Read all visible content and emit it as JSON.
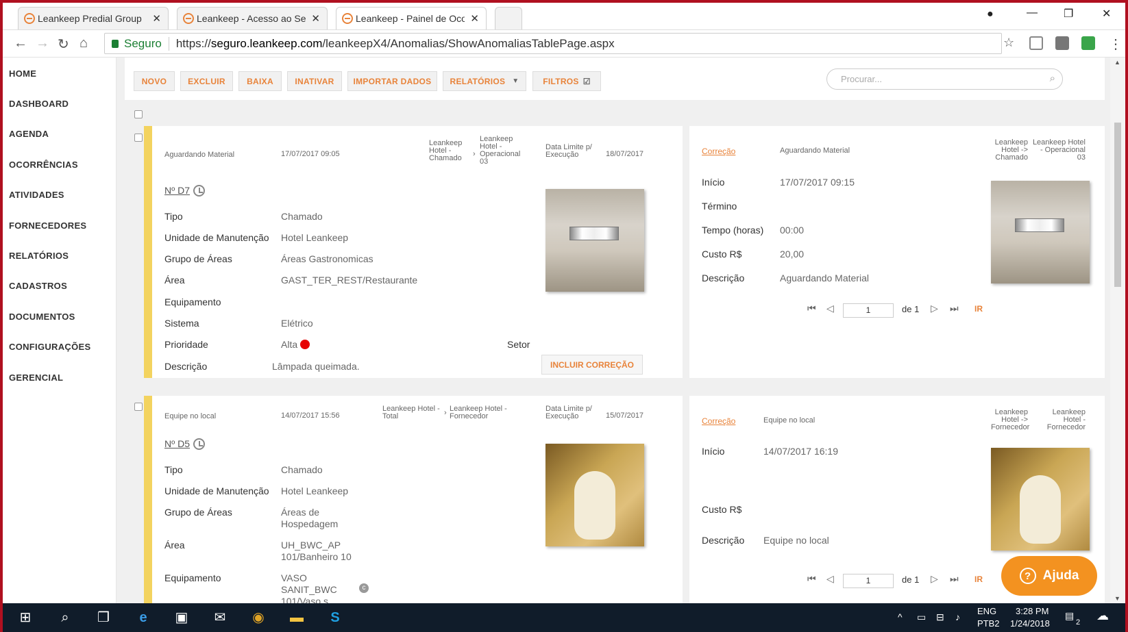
{
  "browser": {
    "tabs": [
      {
        "label": "Leankeep Predial Group"
      },
      {
        "label": "Leankeep - Acesso ao Se"
      },
      {
        "label": "Leankeep - Painel de Oco"
      }
    ],
    "secure_label": "Seguro",
    "url_prefix": "https://",
    "url_domain": "seguro.leankeep.com",
    "url_path": "/leankeepX4/Anomalias/ShowAnomaliasTablePage.aspx"
  },
  "sidebar": {
    "items": [
      "HOME",
      "DASHBOARD",
      "AGENDA",
      "OCORRÊNCIAS",
      "ATIVIDADES",
      "FORNECEDORES",
      "RELATÓRIOS",
      "CADASTROS",
      "DOCUMENTOS",
      "CONFIGURAÇÕES",
      "GERENCIAL"
    ]
  },
  "toolbar": {
    "novo": "NOVO",
    "excluir": "EXCLUIR",
    "baixa": "BAIXA",
    "inativar": "INATIVAR",
    "importar": "IMPORTAR DADOS",
    "relatorios": "RELATÓRIOS",
    "filtros": "FILTROS",
    "search_placeholder": "Procurar..."
  },
  "records": [
    {
      "status": "Aguardando Material",
      "datetime": "17/07/2017 09:05",
      "path_from": "Leankeep Hotel - Chamado",
      "path_to": "Leankeep Hotel - Operacional 03",
      "deadline_label": "Data Limite p/ Execução",
      "deadline": "18/07/2017",
      "number": "Nº D7",
      "fields": {
        "tipo_label": "Tipo",
        "tipo": "Chamado",
        "unidade_label": "Unidade de Manutenção",
        "unidade": "Hotel Leankeep",
        "grupo_label": "Grupo de Áreas",
        "grupo": "Áreas Gastronomicas",
        "area_label": "Área",
        "area": "GAST_TER_REST/Restaurante",
        "equip_label": "Equipamento",
        "equip": "",
        "sistema_label": "Sistema",
        "sistema": "Elétrico",
        "prioridade_label": "Prioridade",
        "prioridade": "Alta",
        "setor_label": "Setor",
        "descricao_label": "Descrição",
        "descricao": "Lâmpada queimada."
      },
      "include_button": "INCLUIR CORREÇÃO",
      "correction": {
        "link": "Correção",
        "status": "Aguardando Material",
        "path_from": "Leankeep Hotel -> Chamado",
        "path_to": "Leankeep Hotel - Operacional 03",
        "inicio_label": "Início",
        "inicio": "17/07/2017 09:15",
        "termino_label": "Término",
        "tempo_label": "Tempo (horas)",
        "tempo": "00:00",
        "custo_label": "Custo R$",
        "custo": "20,00",
        "descricao_label": "Descrição",
        "descricao": "Aguardando Material",
        "page": "1",
        "of": "de 1",
        "go": "IR"
      }
    },
    {
      "status": "Equipe no local",
      "datetime": "14/07/2017 15:56",
      "path_from": "Leankeep Hotel - Total",
      "path_to": "Leankeep Hotel - Fornecedor",
      "deadline_label": "Data Limite p/ Execução",
      "deadline": "15/07/2017",
      "number": "Nº D5",
      "fields": {
        "tipo_label": "Tipo",
        "tipo": "Chamado",
        "unidade_label": "Unidade de Manutenção",
        "unidade": "Hotel Leankeep",
        "grupo_label": "Grupo de Áreas",
        "grupo": "Áreas de Hospedagem",
        "area_label": "Área",
        "area": "UH_BWC_AP 101/Banheiro 10",
        "equip_label": "Equipamento",
        "equip": "VASO SANIT_BWC 101/Vaso s"
      },
      "correction": {
        "link": "Correção",
        "status": "Equipe no local",
        "path_from": "Leankeep Hotel -> Fornecedor",
        "path_to": "Leankeep Hotel - Fornecedor",
        "inicio_label": "Início",
        "inicio": "14/07/2017 16:19",
        "custo_label": "Custo R$",
        "descricao_label": "Descrição",
        "descricao": "Equipe no local",
        "page": "1",
        "of": "de 1",
        "go": "IR"
      }
    }
  ],
  "help_button": "Ajuda",
  "taskbar": {
    "lang": "ENG",
    "layout": "PTB2",
    "time": "3:28 PM",
    "date": "1/24/2018",
    "notifications": "2"
  },
  "colors": {
    "accent": "#e8833a",
    "status_bar": "#f3d35f",
    "priority_high": "#e60000",
    "help": "#f39220"
  }
}
